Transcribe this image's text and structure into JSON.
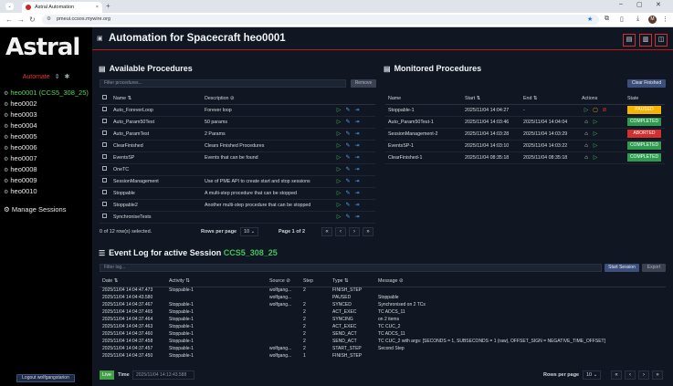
{
  "browser": {
    "tab_title": "Astral Automation",
    "url": "pmeui.ccsos.mywire.org",
    "avatar": "M"
  },
  "sidebar": {
    "logo": "Astral",
    "mode": "Automate",
    "hosts": [
      {
        "label": "heo0001 (CCS5_308_25)",
        "active": true
      },
      {
        "label": "heo0002",
        "active": false
      },
      {
        "label": "heo0003",
        "active": false
      },
      {
        "label": "heo0004",
        "active": false
      },
      {
        "label": "heo0005",
        "active": false
      },
      {
        "label": "heo0006",
        "active": false
      },
      {
        "label": "heo0007",
        "active": false
      },
      {
        "label": "heo0008",
        "active": false
      },
      {
        "label": "heo0009",
        "active": false
      },
      {
        "label": "heo0010",
        "active": false
      }
    ],
    "manage_sessions": "Manage Sessions",
    "logout": "Logout wolfgangstarion"
  },
  "header": {
    "title": "Automation for Spacecraft heo0001"
  },
  "available": {
    "title": "Available Procedures",
    "filter_placeholder": "Filter procedures...",
    "remove_label": "Remove",
    "columns": [
      "Name",
      "Description"
    ],
    "rows": [
      {
        "name": "Auto_ForeverLoop",
        "desc": "Forever loop"
      },
      {
        "name": "Auto_Param50Test",
        "desc": "50 params"
      },
      {
        "name": "Auto_ParamTest",
        "desc": "2 Params"
      },
      {
        "name": "ClearFinished",
        "desc": "Clears Finished Procedures"
      },
      {
        "name": "EventsSP",
        "desc": "Events that can be found"
      },
      {
        "name": "OneTC",
        "desc": ""
      },
      {
        "name": "SessionManagement",
        "desc": "Use of PME API to create start and stop sessions"
      },
      {
        "name": "Stoppable",
        "desc": "A multi-step procedure that can be stopped"
      },
      {
        "name": "Stoppable2",
        "desc": "Another multi-step procedure that can be stopped"
      },
      {
        "name": "SynchroniseTests",
        "desc": ""
      }
    ],
    "selected_text": "0 of 12 row(s) selected.",
    "rows_per_page_label": "Rows per page",
    "rows_per_page": "10",
    "page_text": "Page 1 of 2"
  },
  "monitored": {
    "title": "Monitored Procedures",
    "clear_label": "Clear Finished",
    "columns": [
      "Name",
      "Start",
      "End",
      "Actions",
      "State"
    ],
    "rows": [
      {
        "name": "Stoppable-1",
        "start": "2025/11/04 14:04:27",
        "end": "-",
        "state": "PAUSED",
        "color": "#f5b400"
      },
      {
        "name": "Auto_Param50Test-1",
        "start": "2025/11/04 14:03:46",
        "end": "2025/11/04 14:04:04",
        "state": "COMPLETED",
        "color": "#2e9b4f"
      },
      {
        "name": "SessionManagement-2",
        "start": "2025/11/04 14:03:28",
        "end": "2025/11/04 14:03:29",
        "state": "ABORTED",
        "color": "#d32f2f"
      },
      {
        "name": "EventsSP-1",
        "start": "2025/11/04 14:03:10",
        "end": "2025/11/04 14:03:22",
        "state": "COMPLETED",
        "color": "#2e9b4f"
      },
      {
        "name": "ClearFinished-1",
        "start": "2025/11/04 08:35:18",
        "end": "2025/11/04 08:35:18",
        "state": "COMPLETED",
        "color": "#2e9b4f"
      }
    ]
  },
  "eventlog": {
    "title_prefix": "Event Log for active Session",
    "session": "CCS5_308_25",
    "filter_placeholder": "Filter log...",
    "start_session": "Start Session",
    "export": "Export",
    "columns": [
      "Date",
      "Activity",
      "Source",
      "Step",
      "Type",
      "Message"
    ],
    "rows": [
      {
        "date": "2025/11/04 14:04:47.473",
        "activity": "Stoppable-1",
        "source": "wolfgang...",
        "step": "2",
        "type": "FINISH_STEP",
        "message": ""
      },
      {
        "date": "2025/11/04 14:04:43.580",
        "activity": "",
        "source": "wolfgang...",
        "step": "",
        "type": "PAUSED",
        "message": "Stoppable"
      },
      {
        "date": "2025/11/04 14:04:37.467",
        "activity": "Stoppable-1",
        "source": "wolfgang...",
        "step": "2",
        "type": "SYNCED",
        "message": "Synchronised on 2 TCs"
      },
      {
        "date": "2025/11/04 14:04:37.465",
        "activity": "Stoppable-1",
        "source": "",
        "step": "2",
        "type": "ACT_EXEC",
        "message": "TC ADCS_11"
      },
      {
        "date": "2025/11/04 14:04:37.464",
        "activity": "Stoppable-1",
        "source": "",
        "step": "2",
        "type": "SYNCING",
        "message": "on 2 items"
      },
      {
        "date": "2025/11/04 14:04:37.463",
        "activity": "Stoppable-1",
        "source": "",
        "step": "2",
        "type": "ACT_EXEC",
        "message": "TC CUC_2"
      },
      {
        "date": "2025/11/04 14:04:37.460",
        "activity": "Stoppable-1",
        "source": "",
        "step": "2",
        "type": "SEND_ACT",
        "message": "TC ADCS_11"
      },
      {
        "date": "2025/11/04 14:04:37.458",
        "activity": "Stoppable-1",
        "source": "",
        "step": "2",
        "type": "SEND_ACT",
        "message": "TC CUC_2 with args: [SECONDS = 1, SUBSECONDS = 1 (raw), OFFSET_SIGN = NEGATIVE_TIME_OFFSET]"
      },
      {
        "date": "2025/11/04 14:04:37.457",
        "activity": "Stoppable-1",
        "source": "wolfgang...",
        "step": "2",
        "type": "START_STEP",
        "message": "Second Step"
      },
      {
        "date": "2025/11/04 14:04:37.450",
        "activity": "Stoppable-1",
        "source": "wolfgang...",
        "step": "1",
        "type": "FINISH_STEP",
        "message": ""
      }
    ],
    "live": "Live",
    "time_label": "Time",
    "time_value": "2025/11/04 14:13:43.588",
    "rows_per_page_label": "Rows per page",
    "rows_per_page": "10"
  }
}
